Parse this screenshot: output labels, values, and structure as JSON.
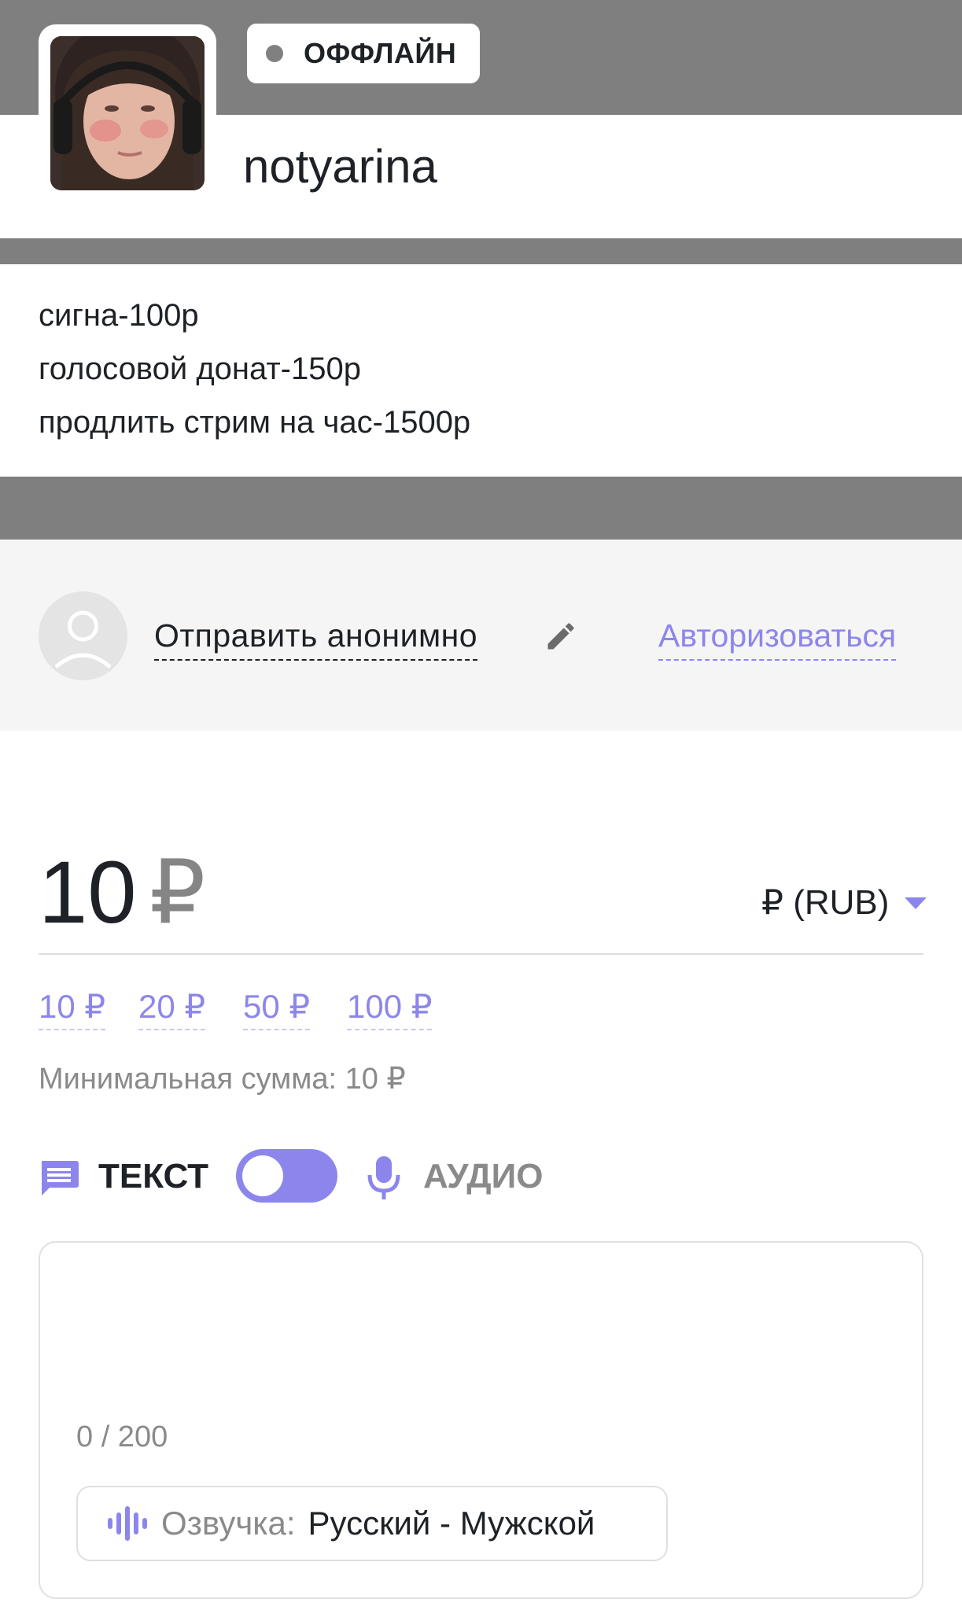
{
  "header": {
    "status": "ОФФЛАЙН",
    "streamer_name": "notyarina"
  },
  "description": {
    "lines": [
      "сигна-100р",
      "голосовой донат-150р",
      "продлить стрим на час-1500р"
    ]
  },
  "sender": {
    "anonymous_label": "Отправить анонимно",
    "login_label": "Авторизоваться"
  },
  "amount": {
    "value": "10",
    "sign": "₽",
    "currency": "₽ (RUB)",
    "presets": [
      "10 ₽",
      "20 ₽",
      "50 ₽",
      "100 ₽"
    ],
    "minimum": "Минимальная сумма: 10 ₽"
  },
  "mode": {
    "text_label": "ТЕКСТ",
    "audio_label": "АУДИО",
    "selected": "text"
  },
  "message": {
    "counter": "0 / 200",
    "voice_label": "Озвучка:",
    "voice_value": "Русский - Мужской"
  },
  "colors": {
    "accent": "#8c86ec",
    "band": "#7f7f7f",
    "user_bar": "#f5f5f5",
    "text": "#1e2226",
    "muted": "#8a8a8a"
  },
  "icons": [
    "status-dot-icon",
    "pencil-icon",
    "user-placeholder-icon",
    "message-icon",
    "microphone-icon",
    "voice-wave-icon",
    "chevron-down-icon"
  ]
}
